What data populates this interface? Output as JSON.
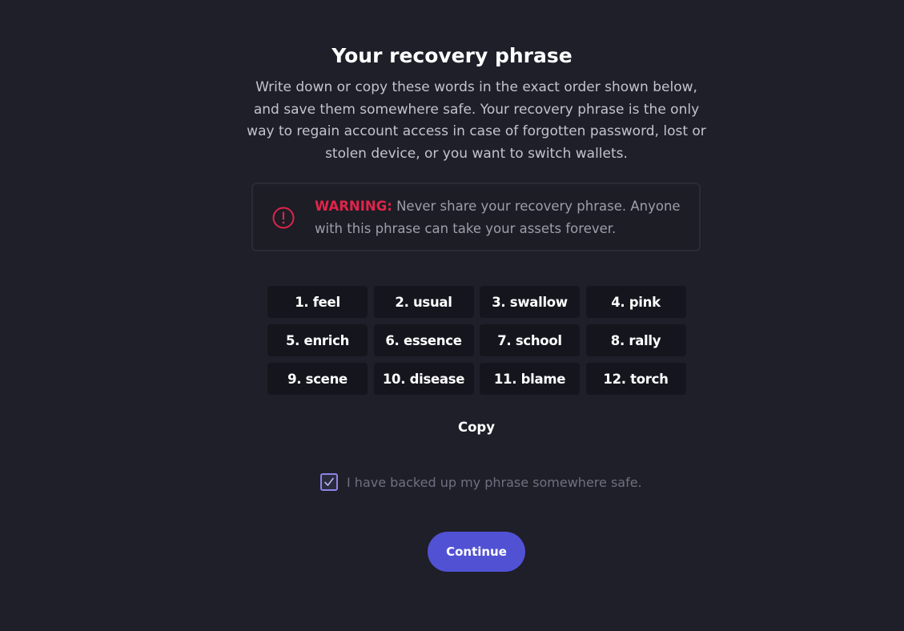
{
  "title": "Your recovery phrase",
  "description": "Write down or copy these words in the exact order shown below, and save them somewhere safe. Your recovery phrase is the only way to regain account access in case of forgotten password, lost or stolen device, or you want to switch wallets.",
  "warning": {
    "label": "WARNING:",
    "text": " Never share your recovery phrase. Anyone with this phrase can take your assets forever.",
    "icon": "alert-circle-icon",
    "color": "#e0244a"
  },
  "words": [
    "1. feel",
    "2. usual",
    "3. swallow",
    "4. pink",
    "5. enrich",
    "6. essence",
    "7. school",
    "8. rally",
    "9. scene",
    "10. disease",
    "11. blame",
    "12. torch"
  ],
  "copy_label": "Copy",
  "backup": {
    "label": "I have backed up my phrase somewhere safe.",
    "checked": true
  },
  "continue_label": "Continue",
  "colors": {
    "background": "#1e1f28",
    "accent": "#5151d4",
    "word_bg": "#15161d"
  }
}
